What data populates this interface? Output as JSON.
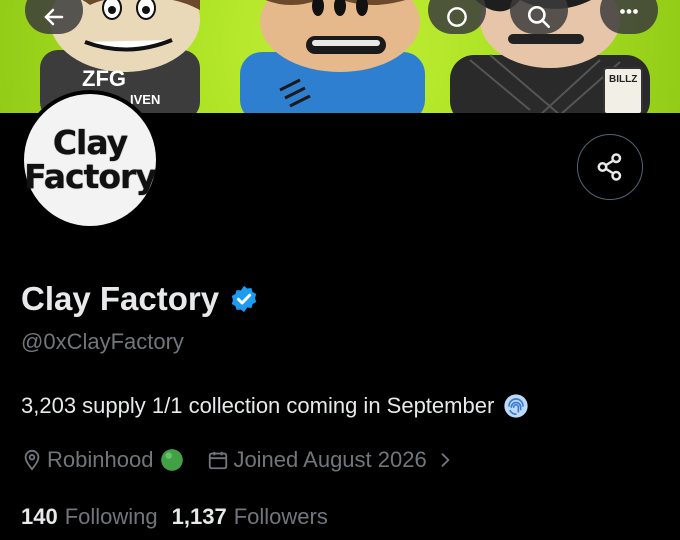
{
  "banner": {
    "sign_left": "ZFG",
    "sign_left_sub": "IVEN",
    "sign_right": "BILLZ",
    "background_color": "#a8e020"
  },
  "header": {
    "back_icon": "back-arrow-icon",
    "refresh_icon": "refresh-icon",
    "search_icon": "search-icon",
    "more_icon": "more-icon"
  },
  "profile": {
    "avatar_line1": "Clay",
    "avatar_line2": "Factory",
    "display_name": "Clay Factory",
    "verified": true,
    "verified_color": "#1d9bf0",
    "handle": "@0xClayFactory",
    "bio": "3,203 supply 1/1 collection coming in September",
    "bio_emoji": "fingerprint-emoji",
    "location": "Robinhood",
    "location_emoji": "green-circle-emoji",
    "joined": "Joined August 2026",
    "following_count": "140",
    "following_label": "Following",
    "followers_count": "1,137",
    "followers_label": "Followers"
  },
  "actions": {
    "share_icon": "share-icon"
  }
}
